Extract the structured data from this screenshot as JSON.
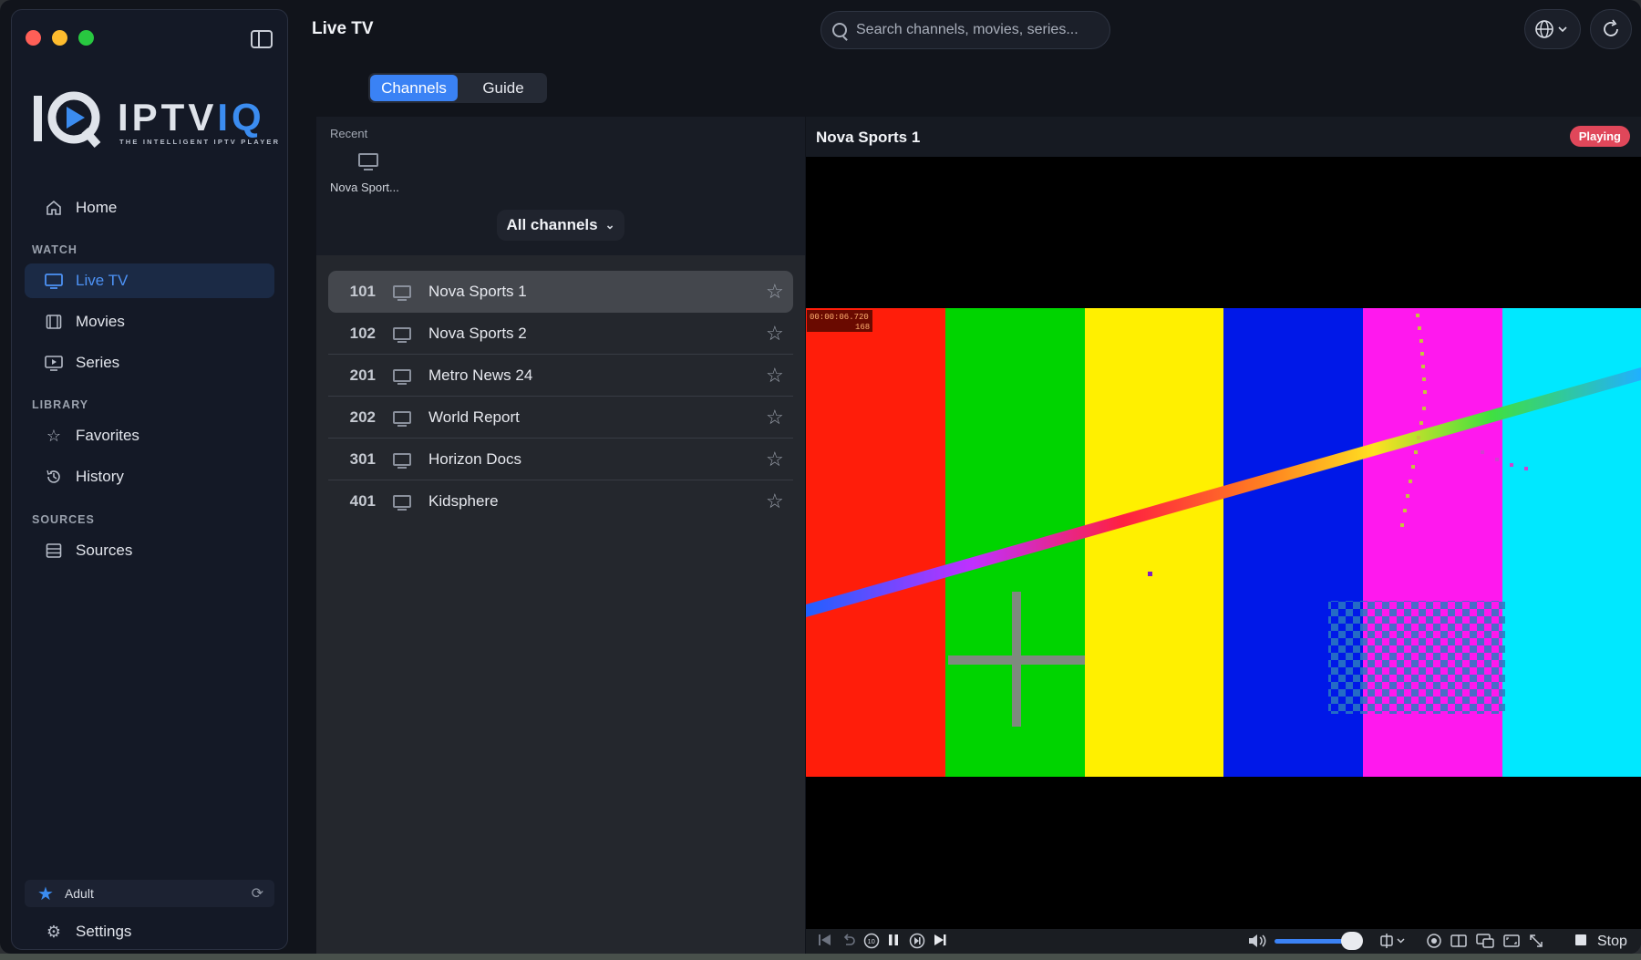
{
  "window": {
    "title": "Live TV"
  },
  "sidebar": {
    "logo": {
      "name": "IPTV",
      "accent": "IQ",
      "tagline": "THE INTELLIGENT IPTV PLAYER"
    },
    "home": "Home",
    "sections": {
      "watch": "WATCH",
      "library": "LIBRARY",
      "sources": "SOURCES"
    },
    "items": {
      "live_tv": "Live TV",
      "movies": "Movies",
      "series": "Series",
      "favorites": "Favorites",
      "history": "History",
      "sources": "Sources"
    },
    "profile": "Adult",
    "settings": "Settings"
  },
  "search": {
    "placeholder": "Search channels, movies, series..."
  },
  "tabs": {
    "channels": "Channels",
    "guide": "Guide"
  },
  "channels_panel": {
    "recent_label": "Recent",
    "recent": [
      {
        "name": "Nova Sport..."
      }
    ],
    "filter": "All channels",
    "list": [
      {
        "number": "101",
        "name": "Nova Sports 1"
      },
      {
        "number": "102",
        "name": "Nova Sports 2"
      },
      {
        "number": "201",
        "name": "Metro News 24"
      },
      {
        "number": "202",
        "name": "World Report"
      },
      {
        "number": "301",
        "name": "Horizon Docs"
      },
      {
        "number": "401",
        "name": "Kidsphere"
      }
    ]
  },
  "player": {
    "channel": "Nova Sports 1",
    "status": "Playing",
    "timestamp": "00:00:06.720",
    "frame": "168",
    "volume": 0.85,
    "stop_label": "Stop"
  },
  "colors": {
    "accent": "#3a82f5",
    "playing": "#e0475a",
    "sidebar_bg": "#141926"
  }
}
